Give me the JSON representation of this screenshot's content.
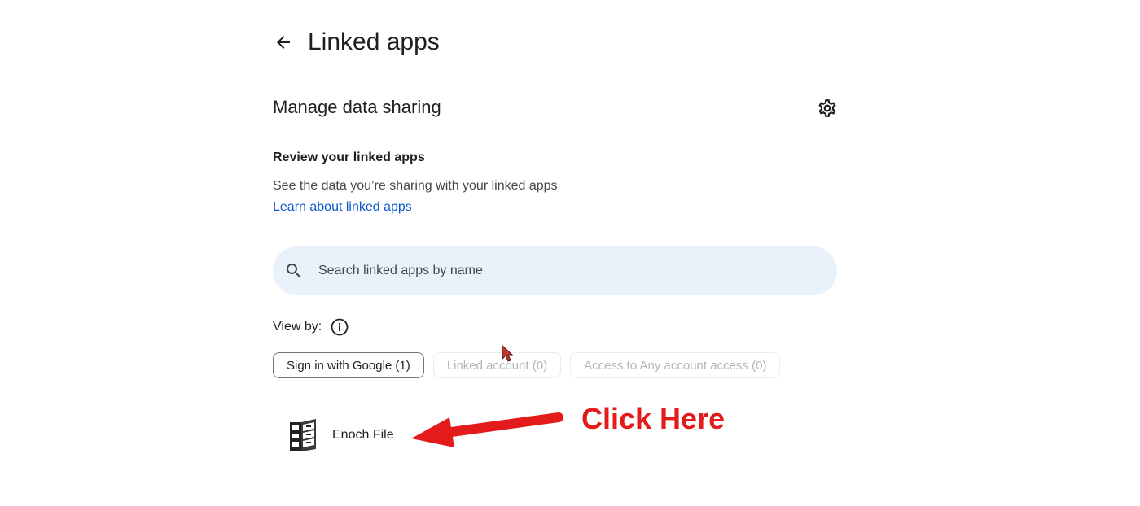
{
  "header": {
    "title": "Linked apps"
  },
  "section": {
    "title": "Manage data sharing"
  },
  "review": {
    "heading": "Review your linked apps",
    "description": "See the data you’re sharing with your linked apps",
    "link": "Learn about linked apps"
  },
  "search": {
    "placeholder": "Search linked apps by name",
    "value": ""
  },
  "view_by": {
    "label": "View by:"
  },
  "filters": [
    {
      "label": "Sign in with Google (1)",
      "state": "selected"
    },
    {
      "label": "Linked account (0)",
      "state": "disabled"
    },
    {
      "label": "Access to Any account access (0)",
      "state": "disabled"
    }
  ],
  "apps": [
    {
      "name": "Enoch File",
      "icon": "file-cabinet-icon"
    }
  ],
  "annotation": {
    "text": "Click Here",
    "color": "#e41b1b"
  },
  "icons": {
    "back": "arrow-left-icon",
    "settings": "gear-icon",
    "search": "search-icon",
    "info": "info-icon"
  },
  "colors": {
    "link": "#0b57d0",
    "search_bg": "#e9f1fb"
  }
}
